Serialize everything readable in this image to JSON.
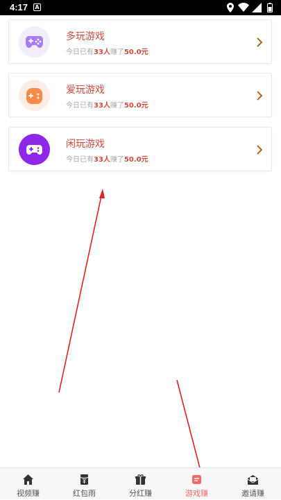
{
  "status_bar": {
    "time": "4:17",
    "notification_letter": "A"
  },
  "games": [
    {
      "title": "多玩游戏",
      "prefix": "今日已有",
      "count": "33人",
      "middle": "赚了",
      "amount": "50.0元",
      "icon": "gamepad-purple-icon"
    },
    {
      "title": "爱玩游戏",
      "prefix": "今日已有",
      "count": "33人",
      "middle": "赚了",
      "amount": "50.0元",
      "icon": "gamepad-orange-icon"
    },
    {
      "title": "闲玩游戏",
      "prefix": "今日已有",
      "count": "33人",
      "middle": "赚了",
      "amount": "50.0元",
      "icon": "gamepad-violet-icon"
    }
  ],
  "tabs": [
    {
      "label": "视频赚",
      "icon": "home-icon"
    },
    {
      "label": "红包雨",
      "icon": "red-packet-icon"
    },
    {
      "label": "分红赚",
      "icon": "gift-icon"
    },
    {
      "label": "游戏赚",
      "icon": "game-icon",
      "active": true
    },
    {
      "label": "邀请赚",
      "icon": "invite-icon"
    }
  ],
  "colors": {
    "accent": "#d14a3c",
    "active_tab": "#f06a6a",
    "chevron": "#b5651d"
  }
}
